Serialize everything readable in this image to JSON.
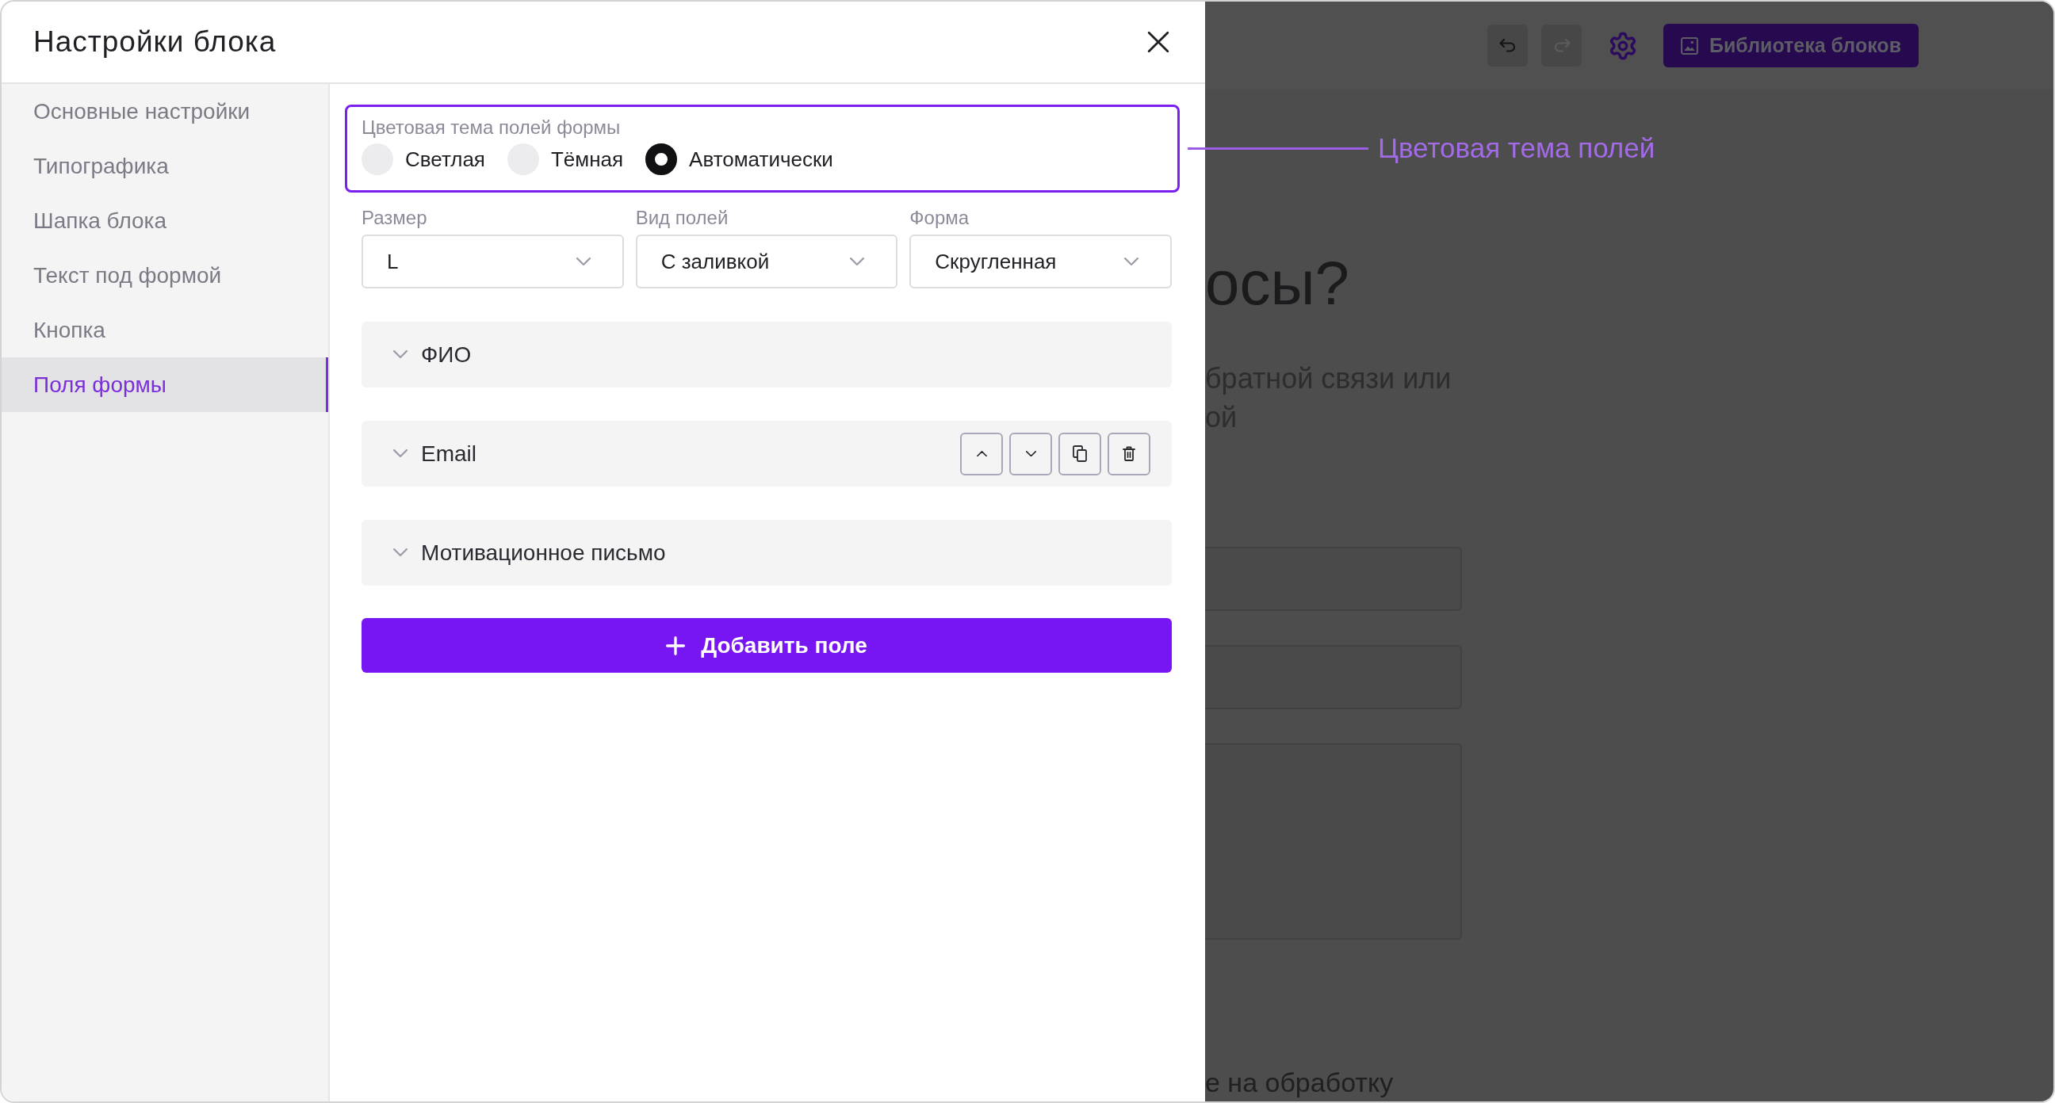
{
  "dialog": {
    "title": "Настройки блока"
  },
  "sidebar": {
    "items": [
      {
        "label": "Основные настройки",
        "selected": false
      },
      {
        "label": "Типографика",
        "selected": false
      },
      {
        "label": "Шапка блока",
        "selected": false
      },
      {
        "label": "Текст под формой",
        "selected": false
      },
      {
        "label": "Кнопка",
        "selected": false
      },
      {
        "label": "Поля формы",
        "selected": true
      }
    ]
  },
  "color_theme": {
    "label": "Цветовая тема полей формы",
    "highlighted": true,
    "options": [
      {
        "label": "Светлая",
        "selected": false
      },
      {
        "label": "Тёмная",
        "selected": false
      },
      {
        "label": "Автоматически",
        "selected": true
      }
    ]
  },
  "selects": [
    {
      "label": "Размер",
      "value": "L"
    },
    {
      "label": "Вид полей",
      "value": "С заливкой"
    },
    {
      "label": "Форма",
      "value": "Скругленная"
    }
  ],
  "form_fields": [
    {
      "label": "ФИО",
      "expanded": false,
      "hovered": false
    },
    {
      "label": "Email",
      "expanded": false,
      "hovered": true
    },
    {
      "label": "Мотивационное письмо",
      "expanded": false,
      "hovered": false
    }
  ],
  "add_button": {
    "label": "Добавить поле"
  },
  "annotation": {
    "text": "Цветовая тема полей"
  },
  "toolbar": {
    "history": [
      {
        "kind": "undo",
        "disabled": false
      },
      {
        "kind": "redo",
        "disabled": true
      }
    ],
    "library_button": "Библиотека блоков"
  },
  "background_page": {
    "heading": "осы?",
    "text_lines": [
      "братной связи или",
      "ой"
    ],
    "consent": "е на обработку"
  }
}
